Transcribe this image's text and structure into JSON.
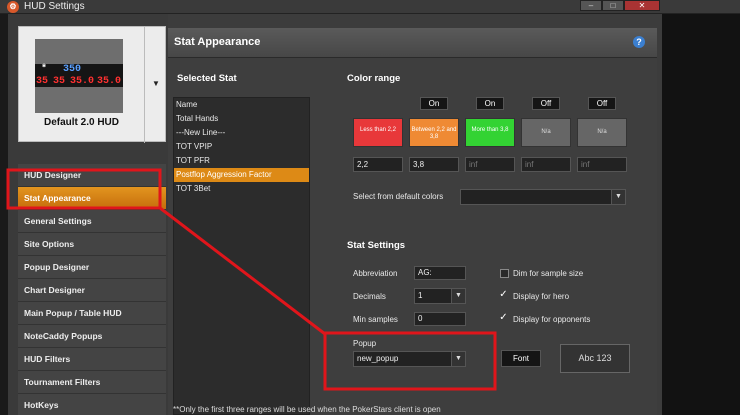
{
  "window": {
    "title": "HUD Settings",
    "app_icon": "logo",
    "controls": [
      "–",
      "□",
      "✕"
    ]
  },
  "hud": {
    "name": "Default 2.0 HUD",
    "preview_row1": [
      "*",
      "350"
    ],
    "preview_row2": [
      "35",
      "35",
      "35.0",
      "35.0"
    ]
  },
  "menu": [
    {
      "label": "HUD Designer"
    },
    {
      "label": "Stat Appearance",
      "active": true
    },
    {
      "label": "General Settings"
    },
    {
      "label": "Site Options"
    },
    {
      "label": "Popup Designer"
    },
    {
      "label": "Chart Designer"
    },
    {
      "label": "Main Popup / Table HUD"
    },
    {
      "label": "NoteCaddy Popups"
    },
    {
      "label": "HUD Filters"
    },
    {
      "label": "Tournament Filters"
    },
    {
      "label": "HotKeys"
    }
  ],
  "header": {
    "title": "Stat Appearance",
    "help": "?"
  },
  "selected_stat": {
    "heading": "Selected Stat",
    "items": [
      "Name",
      "Total Hands",
      "---New Line---",
      "TOT VPIP",
      "TOT PFR",
      "Postflop Aggression Factor",
      "TOT 3Bet"
    ],
    "selected": "Postflop Aggression Factor"
  },
  "color_range": {
    "heading": "Color range",
    "toggles": [
      "On",
      "On",
      "Off",
      "Off",
      "Off"
    ],
    "swatches": [
      {
        "label": "Less than 2,2",
        "color": "#e8383a",
        "text_color": "#ffffff"
      },
      {
        "label": "Between 2,2 and 3,8",
        "color": "#ef8a34",
        "text_color": "#ffffff"
      },
      {
        "label": "More than 3,8",
        "color": "#33d333",
        "text_color": "#ffffff"
      },
      {
        "label": "N/a",
        "color": "#666666",
        "text_color": "#dddddd"
      },
      {
        "label": "N/a",
        "color": "#666666",
        "text_color": "#dddddd"
      }
    ],
    "values": [
      "2,2",
      "3,8",
      "inf",
      "inf",
      "inf"
    ],
    "default_colors_label": "Select from default colors",
    "default_colors_value": ""
  },
  "stat_settings": {
    "heading": "Stat Settings",
    "abbreviation_label": "Abbreviation",
    "abbreviation_value": "AG:",
    "decimals_label": "Decimals",
    "decimals_value": "1",
    "min_samples_label": "Min samples",
    "min_samples_value": "0",
    "popup_label": "Popup",
    "popup_value": "new_popup",
    "font_label": "Font",
    "preview_text": "Abc 123",
    "dim_label": "Dim for sample size",
    "dim_checked": false,
    "hero_label": "Display for hero",
    "hero_checked": true,
    "opponents_label": "Display for opponents",
    "opponents_checked": true
  },
  "footnote": "**Only the first three ranges will be used when the PokerStars client is open",
  "colors": {
    "accent": "#e2951f",
    "annotation": "#e0151b",
    "hud_blue": "#5aa0ff",
    "hud_red": "#ff3030"
  }
}
